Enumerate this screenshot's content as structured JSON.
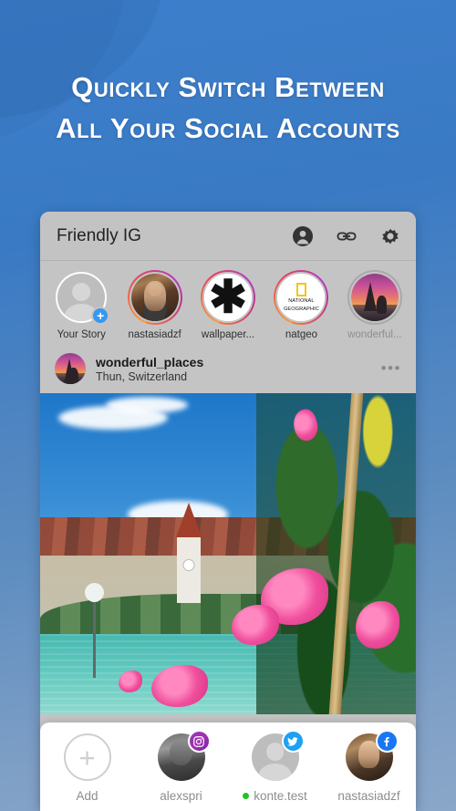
{
  "promo": {
    "headline": "Quickly Switch Between\nAll Your Social  Accounts",
    "background_top_color": "#3d7fcc",
    "background_bottom_color": "#8aa7c9"
  },
  "app": {
    "header": {
      "title": "Friendly IG",
      "icons": [
        {
          "name": "account-icon",
          "glyph": "person-circle"
        },
        {
          "name": "link-icon",
          "glyph": "chain-link"
        },
        {
          "name": "settings-icon",
          "glyph": "gear"
        }
      ]
    },
    "stories": [
      {
        "label": "Your Story",
        "avatar": "placeholder",
        "ring": "none",
        "has_add_badge": true,
        "dim": false
      },
      {
        "label": "nastasiadzf",
        "avatar": "portrait",
        "ring": "gradient",
        "has_add_badge": false,
        "dim": false
      },
      {
        "label": "wallpaper...",
        "avatar": "asterisk",
        "ring": "gradient",
        "has_add_badge": false,
        "dim": false
      },
      {
        "label": "natgeo",
        "avatar": "natgeo-logo",
        "ring": "gradient",
        "has_add_badge": false,
        "dim": false
      },
      {
        "label": "wonderful...",
        "avatar": "paris-sunset",
        "ring": "seen",
        "has_add_badge": false,
        "dim": true
      }
    ],
    "natgeo_logo": {
      "line1": "NATIONAL",
      "line2": "GEOGRAPHIC",
      "rect_color": "#f5c518"
    },
    "post": {
      "username": "wonderful_places",
      "location": "Thun, Switzerland",
      "more_options": "•••",
      "photo_alt": "Thun Switzerland old town by turquoise river with pink flowers"
    },
    "account_switcher": [
      {
        "label": "Add",
        "avatar": "plus",
        "badge": null,
        "active": false
      },
      {
        "label": "alexspri",
        "avatar": "photo-bw-man",
        "badge": "instagram",
        "active": false
      },
      {
        "label": "konte.test",
        "avatar": "placeholder",
        "badge": "twitter",
        "active": true
      },
      {
        "label": "nastasiadzf",
        "avatar": "photo-woman",
        "badge": "facebook",
        "active": false
      }
    ],
    "badge_colors": {
      "instagram": "#a42fae",
      "twitter": "#1da1f2",
      "facebook": "#1877f2",
      "active_dot": "#21c421"
    },
    "your_story_add_badge": "+",
    "add_account_glyph": "+"
  }
}
